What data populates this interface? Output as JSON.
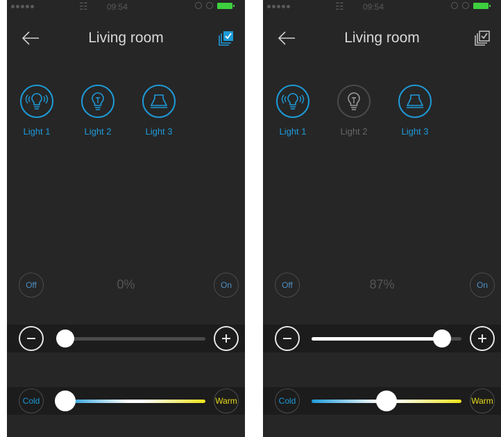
{
  "screens": [
    {
      "status": {
        "time": "09:54"
      },
      "title": "Living room",
      "lights": [
        {
          "label": "Light 1",
          "icon": "speaker-bulb-icon",
          "active": true
        },
        {
          "label": "Light 2",
          "icon": "bulb-icon",
          "active": true
        },
        {
          "label": "Light 3",
          "icon": "ceiling-lamp-icon",
          "active": true
        }
      ],
      "off_label": "Off",
      "on_label": "On",
      "brightness_text": "0%",
      "brightness": 0,
      "cold_label": "Cold",
      "warm_label": "Warm",
      "temperature": 0
    },
    {
      "status": {
        "time": "09:54"
      },
      "title": "Living room",
      "lights": [
        {
          "label": "Light 1",
          "icon": "speaker-bulb-icon",
          "active": true
        },
        {
          "label": "Light 2",
          "icon": "bulb-icon",
          "active": false
        },
        {
          "label": "Light 3",
          "icon": "ceiling-lamp-icon",
          "active": true
        }
      ],
      "off_label": "Off",
      "on_label": "On",
      "brightness_text": "87%",
      "brightness": 0.87,
      "cold_label": "Cold",
      "warm_label": "Warm",
      "temperature": 0.5
    }
  ],
  "colors": {
    "accent": "#1e9ad8",
    "cold": "#1e9ad8",
    "warm": "#f0e21a",
    "battery": "#3ecf3e"
  }
}
